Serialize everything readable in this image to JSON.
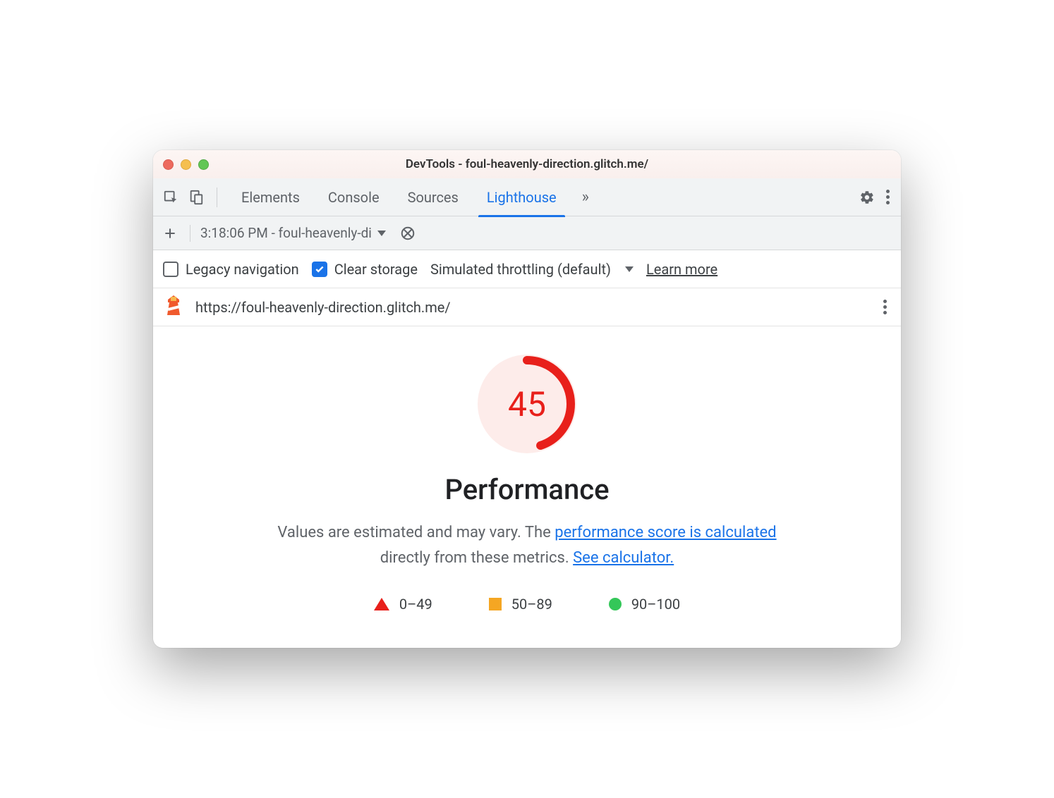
{
  "window": {
    "title": "DevTools - foul-heavenly-direction.glitch.me/"
  },
  "tabs": {
    "items": [
      "Elements",
      "Console",
      "Sources",
      "Lighthouse"
    ],
    "active_index": 3
  },
  "subtoolbar": {
    "report_label": "3:18:06 PM - foul-heavenly-di"
  },
  "options": {
    "legacy_navigation_label": "Legacy navigation",
    "legacy_navigation_checked": false,
    "clear_storage_label": "Clear storage",
    "clear_storage_checked": true,
    "throttling_label": "Simulated throttling (default)",
    "learn_more_label": "Learn more"
  },
  "urlbar": {
    "url": "https://foul-heavenly-direction.glitch.me/"
  },
  "report": {
    "score": "45",
    "title": "Performance",
    "desc_prefix": "Values are estimated and may vary. The ",
    "desc_link1": "performance score is calculated",
    "desc_middle": " directly from these metrics. ",
    "desc_link2": "See calculator.",
    "legend": {
      "low": "0–49",
      "mid": "50–89",
      "high": "90–100"
    }
  }
}
